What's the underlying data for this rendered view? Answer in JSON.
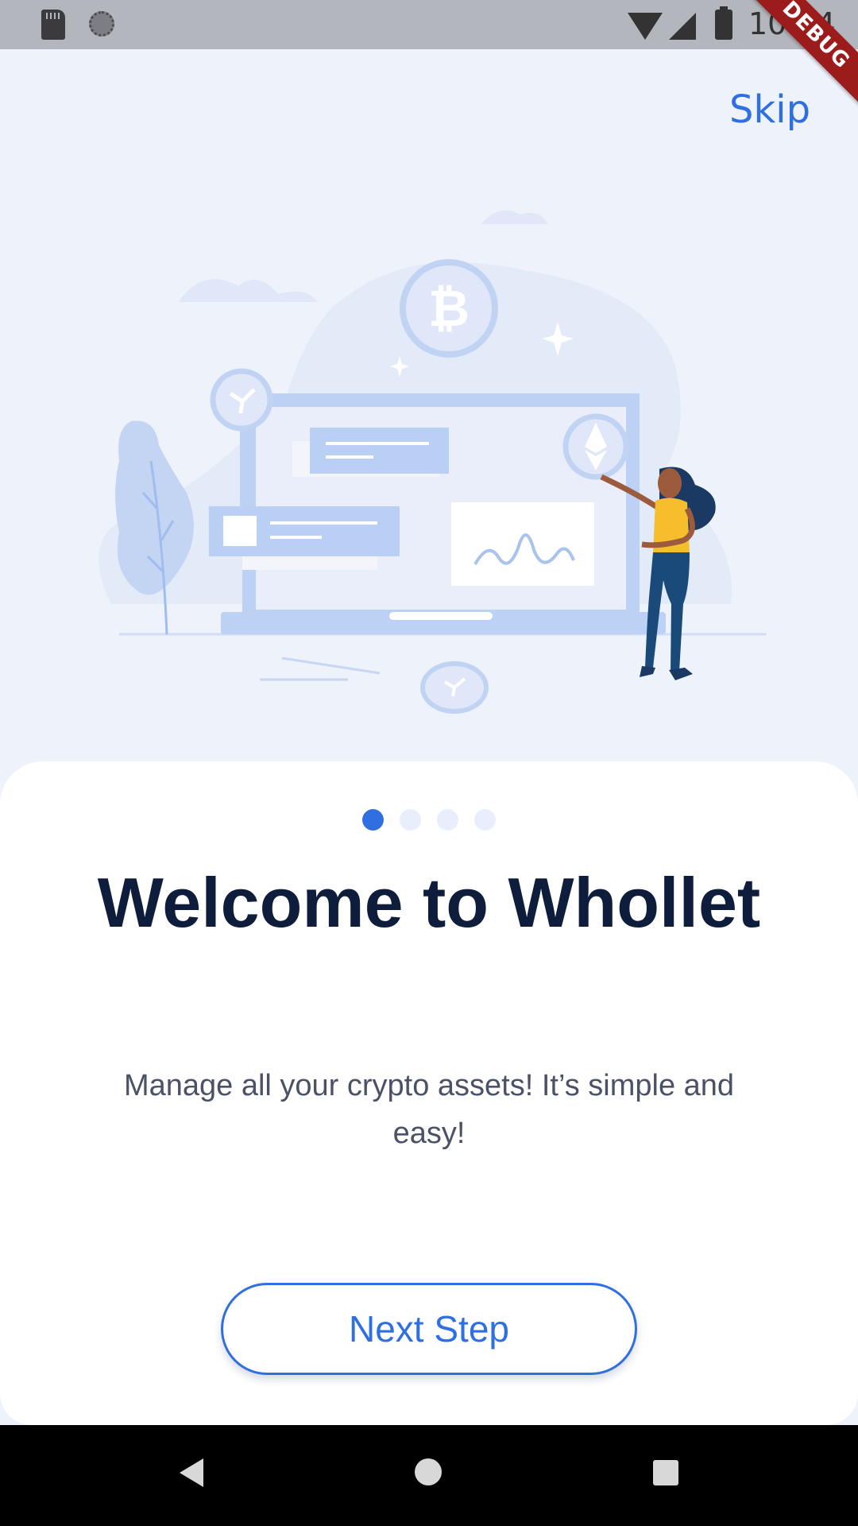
{
  "status_bar": {
    "time": "10:24",
    "icons": [
      "sd-card-icon",
      "sync-icon",
      "wifi-icon",
      "signal-icon",
      "battery-icon"
    ]
  },
  "debug_banner": "DEBUG",
  "header": {
    "skip_label": "Skip"
  },
  "onboarding": {
    "page_index": 1,
    "page_count": 4,
    "title": "Welcome to Whollet",
    "subtitle": "Manage all your crypto assets! It’s simple and easy!",
    "next_label": "Next Step"
  },
  "colors": {
    "accent": "#2f6fe0",
    "title": "#0f1d3c",
    "body": "#4b5266",
    "background": "#eef2fb",
    "card": "#ffffff"
  },
  "nav_bar": {
    "icons": [
      "back-icon",
      "home-icon",
      "recent-apps-icon"
    ]
  }
}
